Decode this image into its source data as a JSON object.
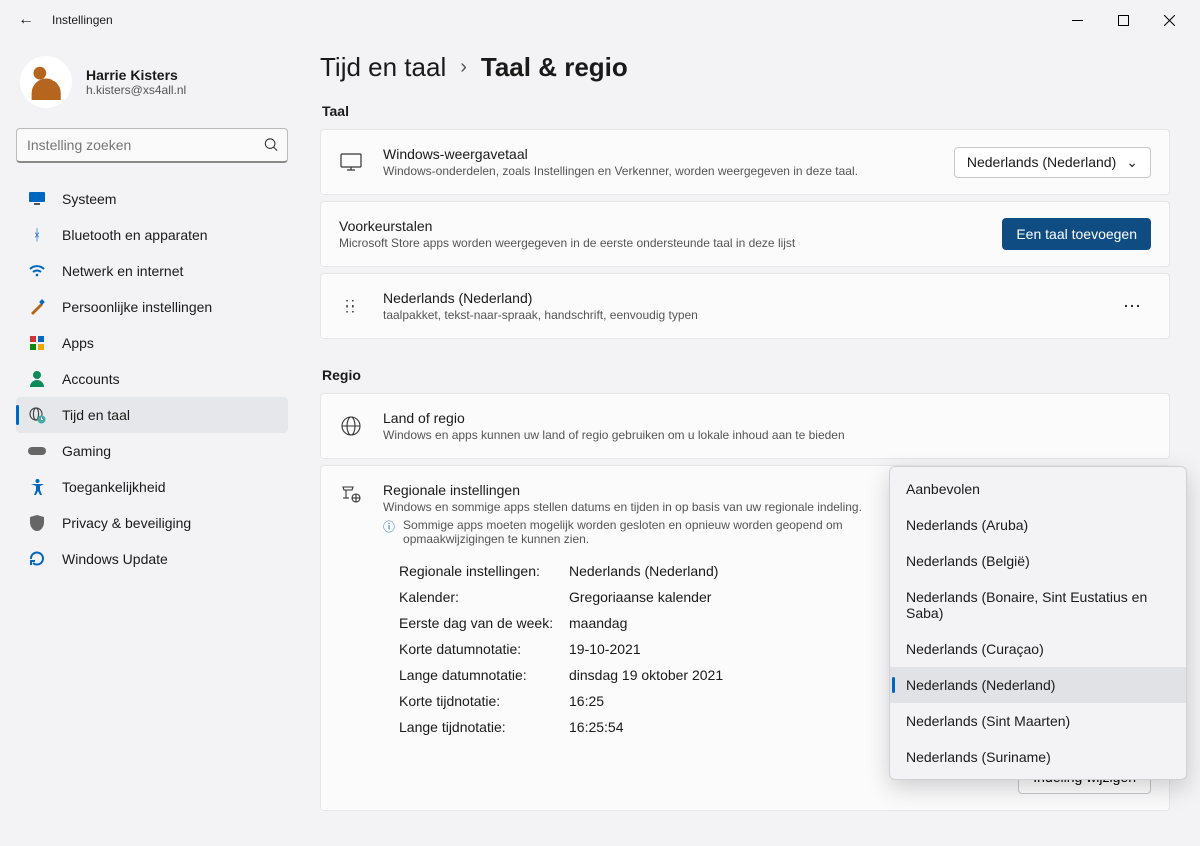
{
  "window": {
    "title": "Instellingen"
  },
  "profile": {
    "name": "Harrie Kisters",
    "email": "h.kisters@xs4all.nl"
  },
  "search": {
    "placeholder": "Instelling zoeken"
  },
  "nav": [
    {
      "label": "Systeem",
      "icon": "monitor"
    },
    {
      "label": "Bluetooth en apparaten",
      "icon": "bluetooth"
    },
    {
      "label": "Netwerk en internet",
      "icon": "wifi"
    },
    {
      "label": "Persoonlijke instellingen",
      "icon": "brush"
    },
    {
      "label": "Apps",
      "icon": "apps"
    },
    {
      "label": "Accounts",
      "icon": "person"
    },
    {
      "label": "Tijd en taal",
      "icon": "globe-clock",
      "active": true
    },
    {
      "label": "Gaming",
      "icon": "gamepad"
    },
    {
      "label": "Toegankelijkheid",
      "icon": "accessibility"
    },
    {
      "label": "Privacy & beveiliging",
      "icon": "shield"
    },
    {
      "label": "Windows Update",
      "icon": "update"
    }
  ],
  "breadcrumb": {
    "parent": "Tijd en taal",
    "current": "Taal & regio"
  },
  "sections": {
    "lang": "Taal",
    "region": "Regio"
  },
  "display_lang": {
    "title": "Windows-weergavetaal",
    "desc": "Windows-onderdelen, zoals Instellingen en Verkenner, worden weergegeven in deze taal.",
    "value": "Nederlands (Nederland)"
  },
  "pref_lang": {
    "title": "Voorkeurstalen",
    "desc": "Microsoft Store apps worden weergegeven in de eerste ondersteunde taal in deze lijst",
    "add_btn": "Een taal toevoegen",
    "item": {
      "name": "Nederlands (Nederland)",
      "features": "taalpakket, tekst-naar-spraak, handschrift, eenvoudig typen"
    }
  },
  "country": {
    "title": "Land of regio",
    "desc": "Windows en apps kunnen uw land of regio gebruiken om u lokale inhoud aan te bieden"
  },
  "regional": {
    "title": "Regionale instellingen",
    "desc": "Windows en sommige apps stellen datums en tijden in op basis van uw regionale indeling.",
    "info": "Sommige apps moeten mogelijk worden gesloten en opnieuw worden geopend om opmaakwijzigingen te kunnen zien.",
    "rows": [
      {
        "k": "Regionale instellingen:",
        "v": "Nederlands (Nederland)"
      },
      {
        "k": "Kalender:",
        "v": "Gregoriaanse kalender"
      },
      {
        "k": "Eerste dag van de week:",
        "v": "maandag"
      },
      {
        "k": "Korte datumnotatie:",
        "v": "19-10-2021"
      },
      {
        "k": "Lange datumnotatie:",
        "v": "dinsdag 19 oktober 2021"
      },
      {
        "k": "Korte tijdnotatie:",
        "v": "16:25"
      },
      {
        "k": "Lange tijdnotatie:",
        "v": "16:25:54"
      }
    ],
    "change_btn": "Indeling wijzigen"
  },
  "popup": {
    "options": [
      "Aanbevolen",
      "Nederlands (Aruba)",
      "Nederlands (België)",
      "Nederlands (Bonaire, Sint Eustatius en Saba)",
      "Nederlands (Curaçao)",
      "Nederlands (Nederland)",
      "Nederlands (Sint Maarten)",
      "Nederlands (Suriname)"
    ],
    "selected_index": 5
  }
}
